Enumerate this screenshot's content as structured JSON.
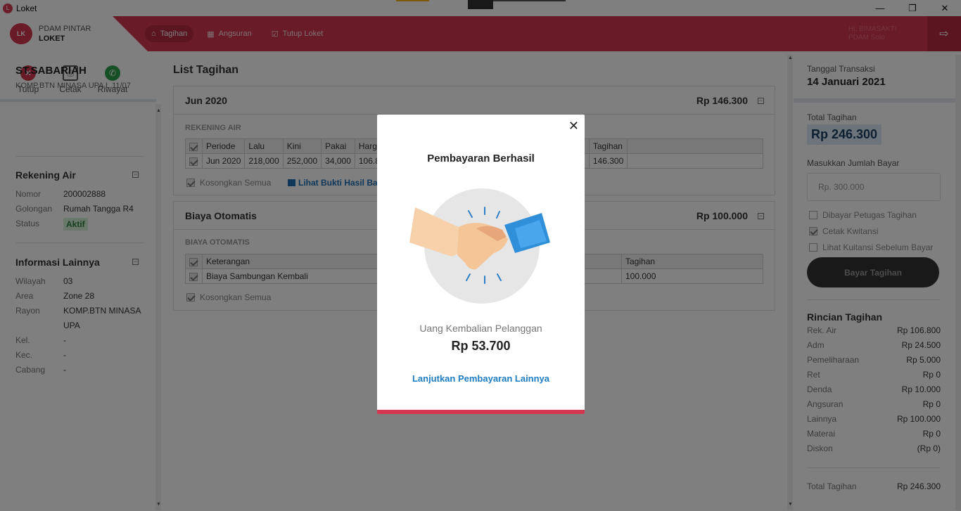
{
  "window": {
    "title": "Loket",
    "icon_text": "L"
  },
  "header": {
    "brand_line1": "PDAM PINTAR",
    "brand_line2": "LOKET",
    "logo_text": "LK",
    "nav": [
      {
        "label": "Tagihan",
        "icon": "home-icon",
        "active": true
      },
      {
        "label": "Angsuran",
        "icon": "calendar-icon",
        "active": false
      },
      {
        "label": "Tutup Loket",
        "icon": "checkbox-icon",
        "active": false
      }
    ],
    "user_greeting": "Hi, BIMASAKTI",
    "user_org": "PDAM Solo"
  },
  "toolbar": {
    "close_label": "Tutup",
    "print_label": "Cetak",
    "history_label": "Riwayat"
  },
  "customer": {
    "name": "ST.SABARIAH",
    "address": "KOMP.BTN MINASA UPA L.11/07",
    "rekening_title": "Rekening Air",
    "nomor_label": "Nomor",
    "nomor": "200002888",
    "golongan_label": "Golongan",
    "golongan": "Rumah Tangga R4",
    "status_label": "Status",
    "status": "Aktif",
    "info_title": "Informasi Lainnya",
    "wilayah_label": "Wilayah",
    "wilayah": "03",
    "area_label": "Area",
    "area": "Zone 28",
    "rayon_label": "Rayon",
    "rayon_line1": "KOMP.BTN MINASA",
    "rayon_line2": "UPA",
    "kel_label": "Kel.",
    "kel": "-",
    "kec_label": "Kec.",
    "kec": "-",
    "cabang_label": "Cabang",
    "cabang": "-"
  },
  "main": {
    "title": "List Tagihan",
    "card1": {
      "title": "Jun 2020",
      "amount": "Rp 146.300",
      "sub": "REKENING AIR",
      "headers": [
        "Periode",
        "Lalu",
        "Kini",
        "Pakai",
        "Harga A",
        "Tagihan"
      ],
      "row": [
        "Jun 2020",
        "218,000",
        "252,000",
        "34,000",
        "106.80",
        "146.300"
      ],
      "clear_label": "Kosongkan Semua",
      "proof_label": "Lihat Bukti Hasil Ba"
    },
    "card2": {
      "title": "Biaya Otomatis",
      "amount": "Rp 100.000",
      "sub": "BIAYA OTOMATIS",
      "headers": [
        "Keterangan",
        "Tagihan"
      ],
      "row": [
        "Biaya Sambungan Kembali",
        "100.000"
      ],
      "clear_label": "Kosongkan Semua"
    }
  },
  "right": {
    "date_label": "Tanggal Transaksi",
    "date": "14 Januari 2021",
    "total_label": "Total Tagihan",
    "total": "Rp 246.300",
    "pay_input_label": "Masukkan Jumlah Bayar",
    "pay_input_placeholder": "Rp. 300.000",
    "opt1": "Dibayar Petugas Tagihan",
    "opt2": "Cetak Kwitansi",
    "opt3": "Lihat Kuitansi Sebelum Bayar",
    "pay_button": "Bayar Tagihan",
    "detail_title": "Rincian Tagihan",
    "details": [
      {
        "k": "Rek. Air",
        "v": "Rp 106.800"
      },
      {
        "k": "Adm",
        "v": "Rp 24.500"
      },
      {
        "k": "Pemeliharaan",
        "v": "Rp 5.000"
      },
      {
        "k": "Ret",
        "v": "Rp 0"
      },
      {
        "k": "Denda",
        "v": "Rp 10.000"
      },
      {
        "k": "Angsuran",
        "v": "Rp 0"
      },
      {
        "k": "Lainnya",
        "v": "Rp 100.000"
      },
      {
        "k": "Materai",
        "v": "Rp 0"
      },
      {
        "k": "Diskon",
        "v": "(Rp 0)"
      }
    ],
    "footer_total_label": "Total Tagihan",
    "footer_total": "Rp 246.300"
  },
  "modal": {
    "title": "Pembayaran Berhasil",
    "change_label": "Uang Kembalian Pelanggan",
    "change_amount": "Rp 53.700",
    "continue_link": "Lanjutkan Pembayaran Lainnya",
    "illustration": "handshake-illustration"
  },
  "colors": {
    "brand": "#d43750",
    "link": "#1e7cc2",
    "accent_top_yellow": "#f4b400"
  }
}
